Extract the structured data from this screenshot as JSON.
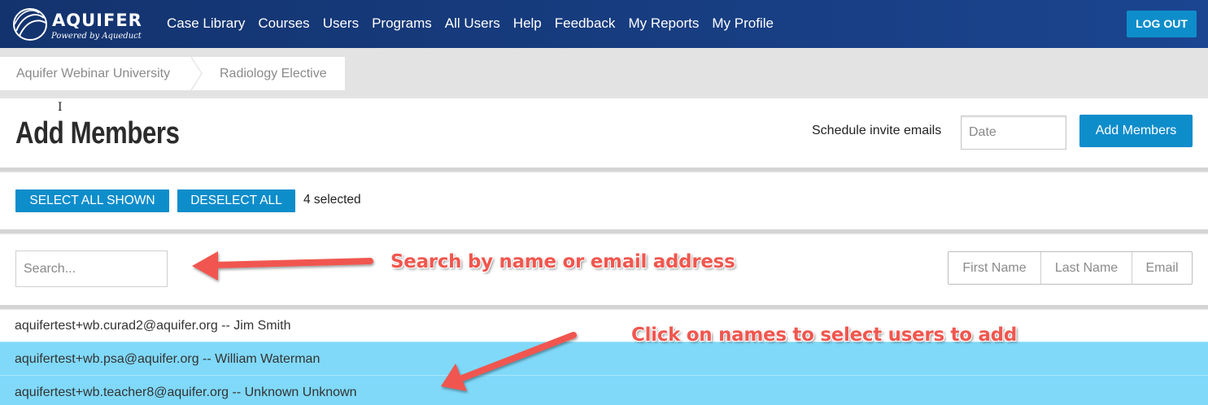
{
  "app": {
    "logo_name": "AQUIFER",
    "logo_tagline": "Powered by Aqueduct",
    "accent": "#0e8dcb",
    "nav_bg": "#13336e"
  },
  "nav": {
    "links": [
      "Case Library",
      "Courses",
      "Users",
      "Programs",
      "All Users",
      "Help",
      "Feedback",
      "My Reports",
      "My Profile"
    ],
    "logout": "LOG OUT"
  },
  "breadcrumb": [
    "Aquifer Webinar University",
    "Radiology Elective"
  ],
  "header": {
    "title": "Add Members",
    "schedule_label": "Schedule invite emails",
    "date_placeholder": "Date",
    "add_button": "Add Members"
  },
  "selection": {
    "select_all": "Select All Shown",
    "deselect_all": "Deselect All",
    "count_text": "4 selected"
  },
  "search": {
    "placeholder": "Search...",
    "sort_options": [
      "First Name",
      "Last Name",
      "Email"
    ]
  },
  "annotations": {
    "search_hint": "Search by name or email address",
    "click_hint": "Click on names to select users to add",
    "color": "#f0574f"
  },
  "users": [
    {
      "text": "aquifertest+wb.curad2@aquifer.org -- Jim Smith",
      "selected": false
    },
    {
      "text": "aquifertest+wb.psa@aquifer.org -- William Waterman",
      "selected": true
    },
    {
      "text": "aquifertest+wb.teacher8@aquifer.org -- Unknown Unknown",
      "selected": true
    }
  ],
  "selected_row_color": "#80d9f9"
}
